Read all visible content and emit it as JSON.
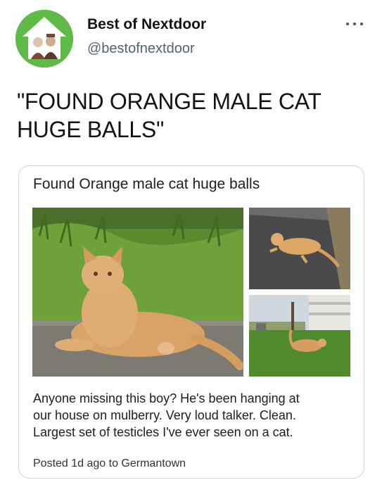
{
  "account": {
    "display_name": "Best of Nextdoor",
    "handle": "@bestofnextdoor",
    "avatar_icon": "house-muppets-avatar",
    "brand_color": "#5fba47"
  },
  "menu": {
    "icon": "more-dots-icon"
  },
  "tweet": {
    "text": "\"FOUND ORANGE MALE CAT\nHUGE BALLS\""
  },
  "post": {
    "title": "Found Orange male cat huge balls",
    "body_lines": [
      "Anyone missing this boy? He's been hanging at",
      "our house on mulberry. Very loud talker. Clean.",
      "Largest set of testicles I've ever seen on a cat."
    ],
    "meta": "Posted 1d ago to Germantown",
    "photos": [
      {
        "name": "orange-cat-lying-on-pavement-photo"
      },
      {
        "name": "orange-cat-on-gravel-photo"
      },
      {
        "name": "orange-cat-in-grass-yard-photo"
      }
    ]
  }
}
